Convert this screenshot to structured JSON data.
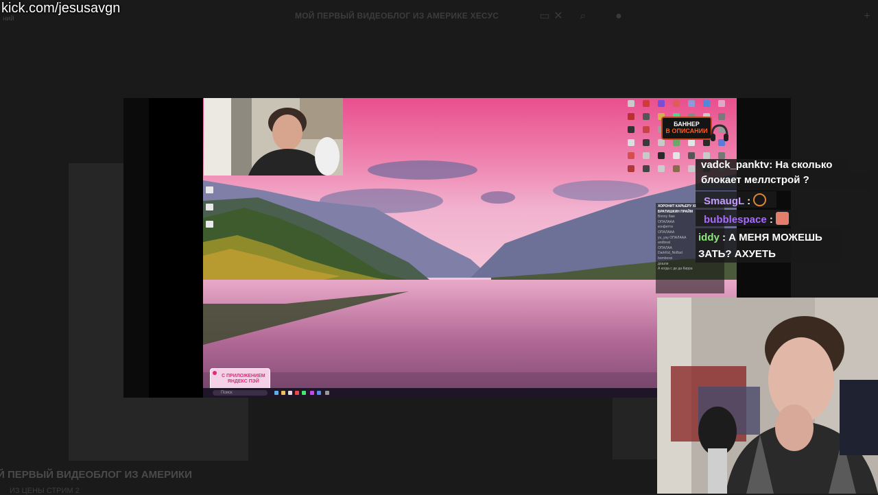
{
  "overlay": {
    "url": "kick.com/jesusavgn"
  },
  "background_page": {
    "title": "МОЙ ПЕРВЫЙ ВИДЕОБЛОГ ИЗ АМЕРИКЕ ХЕСУС",
    "menu_left": "ний",
    "video_title": "Й ПЕРВЫЙ ВИДЕОБЛОГ ИЗ АМЕРИКИ",
    "video_sub": "ИЗ ЦЕНЫ СТРИМ 2"
  },
  "desktop": {
    "banner_line1": "БАННЕР",
    "banner_line2": "В ОПИСАНИИ",
    "ad_text": "С ПРИЛОЖЕНИЕМ\nЯНДЕКС ПЭЙ",
    "taskbar_search": "Поиск",
    "mini_chat": [
      "ХОРОНИТ КАРЬЕРУ ХЕ",
      "БРАТИШКИН ПРАЙМ",
      "Bonny бам",
      "ОПАЛААА",
      "конфетти",
      "ОПАЛААА",
      "yu_yay ОПАЛААА",
      "andbeat",
      "ОПАЛАА",
      "DarkKid_NoBad",
      "bomboxxi",
      "дошли",
      "А когда с де да Кирра"
    ]
  },
  "chat": {
    "messages": [
      {
        "user": "vadck_panktv",
        "user_color": "#ffffff",
        "text": ": На сколько"
      },
      {
        "user": "",
        "user_color": "#ffffff",
        "text": "блокает меллстрой ?"
      },
      {
        "user": "SmaugL",
        "user_color": "#c59bff",
        "text": " : ",
        "emote": "react-icon"
      },
      {
        "user": "bubblespace",
        "user_color": "#a76bff",
        "text": " : ",
        "emote": "cat-emote-icon"
      },
      {
        "user": "iddy",
        "user_color": "#8fe87a",
        "text": " : А МЕНЯ МОЖЕШЬ"
      },
      {
        "user": "",
        "user_color": "#ffffff",
        "text": "ЗАТЬ? АХУЕТЬ"
      }
    ]
  },
  "colors": {
    "page_bg": "#1d1d1d",
    "chat_bg": "#1a1a1a",
    "banner_accent": "#ff5a1f",
    "ad_pink": "#e02a7a"
  }
}
